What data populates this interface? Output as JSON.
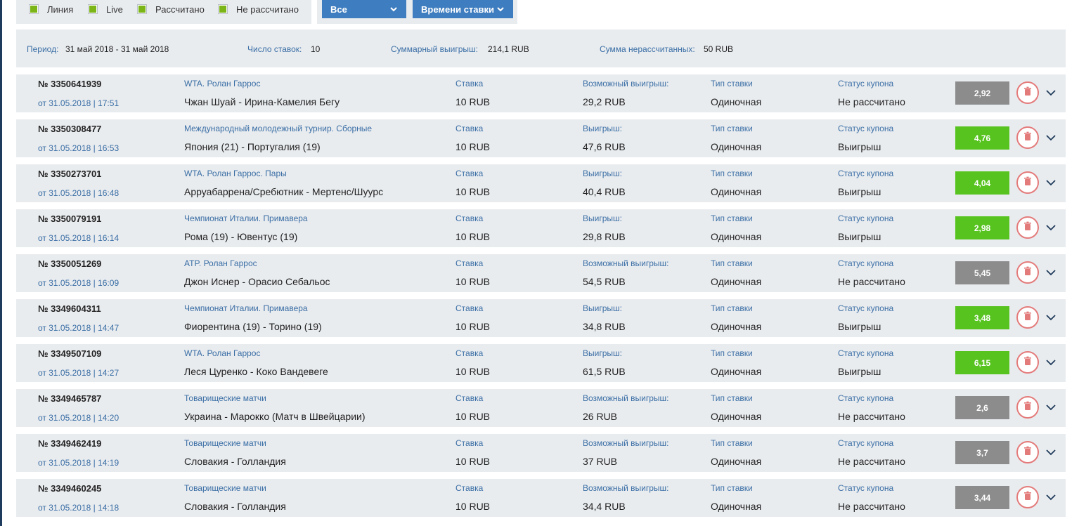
{
  "filters": [
    {
      "label": "Линия"
    },
    {
      "label": "Live"
    },
    {
      "label": "Рассчитано"
    },
    {
      "label": "Не рассчитано"
    }
  ],
  "dropdowns": {
    "status": "Все",
    "sort": "Времени ставки"
  },
  "summary": {
    "period_label": "Период:",
    "period_value": "31 май 2018 - 31 май 2018",
    "count_label": "Число ставок:",
    "count_value": "10",
    "total_win_label": "Суммарный выигрыш:",
    "total_win_value": "214,1 RUB",
    "unsettled_label": "Сумма нерассчитанных:",
    "unsettled_value": "50 RUB"
  },
  "columns": {
    "stake": "Ставка",
    "bet_type": "Тип ставки",
    "status": "Статус купона"
  },
  "colors": {
    "won": "#57c31f",
    "pending": "#8c8c8c",
    "accent": "#3e7dbf",
    "trash": "#e47b7b"
  },
  "icons": {
    "checkbox": "checkbox-checked-icon",
    "chevron": "chevron-down-icon",
    "trash": "trash-icon"
  },
  "bets": [
    {
      "number": "№ 3350641939",
      "date": "от 31.05.2018 | 17:51",
      "tournament": "WTA. Ролан Гаррос",
      "match": "Чжан Шуай - Ирина-Камелия Бегу",
      "stake": "10 RUB",
      "win_label": "Возможный выигрыш:",
      "win": "29,2 RUB",
      "type": "Одиночная",
      "status": "Не рассчитано",
      "odds": "2,92",
      "state": "pending"
    },
    {
      "number": "№ 3350308477",
      "date": "от 31.05.2018 | 16:53",
      "tournament": "Международный молодежный турнир. Сборные",
      "match": "Япония (21) - Португалия (19)",
      "stake": "10 RUB",
      "win_label": "Выигрыш:",
      "win": "47,6 RUB",
      "type": "Одиночная",
      "status": "Выигрыш",
      "odds": "4,76",
      "state": "won"
    },
    {
      "number": "№ 3350273701",
      "date": "от 31.05.2018 | 16:48",
      "tournament": "WTA. Ролан Гаррос. Пары",
      "match": "Арруабаррена/Сребютник - Мертенс/Шуурс",
      "stake": "10 RUB",
      "win_label": "Выигрыш:",
      "win": "40,4 RUB",
      "type": "Одиночная",
      "status": "Выигрыш",
      "odds": "4,04",
      "state": "won"
    },
    {
      "number": "№ 3350079191",
      "date": "от 31.05.2018 | 16:14",
      "tournament": "Чемпионат Италии. Примавера",
      "match": "Рома (19) - Ювентус (19)",
      "stake": "10 RUB",
      "win_label": "Выигрыш:",
      "win": "29,8 RUB",
      "type": "Одиночная",
      "status": "Выигрыш",
      "odds": "2,98",
      "state": "won"
    },
    {
      "number": "№ 3350051269",
      "date": "от 31.05.2018 | 16:09",
      "tournament": "ATP. Ролан Гаррос",
      "match": "Джон Иснер - Орасио Себальос",
      "stake": "10 RUB",
      "win_label": "Возможный выигрыш:",
      "win": "54,5 RUB",
      "type": "Одиночная",
      "status": "Не рассчитано",
      "odds": "5,45",
      "state": "pending"
    },
    {
      "number": "№ 3349604311",
      "date": "от 31.05.2018 | 14:47",
      "tournament": "Чемпионат Италии. Примавера",
      "match": "Фиорентина (19) - Торино (19)",
      "stake": "10 RUB",
      "win_label": "Выигрыш:",
      "win": "34,8 RUB",
      "type": "Одиночная",
      "status": "Выигрыш",
      "odds": "3,48",
      "state": "won"
    },
    {
      "number": "№ 3349507109",
      "date": "от 31.05.2018 | 14:27",
      "tournament": "WTA. Ролан Гаррос",
      "match": "Леся Цуренко - Коко Вандевеге",
      "stake": "10 RUB",
      "win_label": "Выигрыш:",
      "win": "61,5 RUB",
      "type": "Одиночная",
      "status": "Выигрыш",
      "odds": "6,15",
      "state": "won"
    },
    {
      "number": "№ 3349465787",
      "date": "от 31.05.2018 | 14:20",
      "tournament": "Товарищеские матчи",
      "match": "Украина - Марокко (Матч в Швейцарии)",
      "stake": "10 RUB",
      "win_label": "Возможный выигрыш:",
      "win": "26 RUB",
      "type": "Одиночная",
      "status": "Не рассчитано",
      "odds": "2,6",
      "state": "pending"
    },
    {
      "number": "№ 3349462419",
      "date": "от 31.05.2018 | 14:19",
      "tournament": "Товарищеские матчи",
      "match": "Словакия - Голландия",
      "stake": "10 RUB",
      "win_label": "Возможный выигрыш:",
      "win": "37 RUB",
      "type": "Одиночная",
      "status": "Не рассчитано",
      "odds": "3,7",
      "state": "pending"
    },
    {
      "number": "№ 3349460245",
      "date": "от 31.05.2018 | 14:18",
      "tournament": "Товарищеские матчи",
      "match": "Словакия - Голландия",
      "stake": "10 RUB",
      "win_label": "Возможный выигрыш:",
      "win": "34,4 RUB",
      "type": "Одиночная",
      "status": "Не рассчитано",
      "odds": "3,44",
      "state": "pending"
    }
  ]
}
